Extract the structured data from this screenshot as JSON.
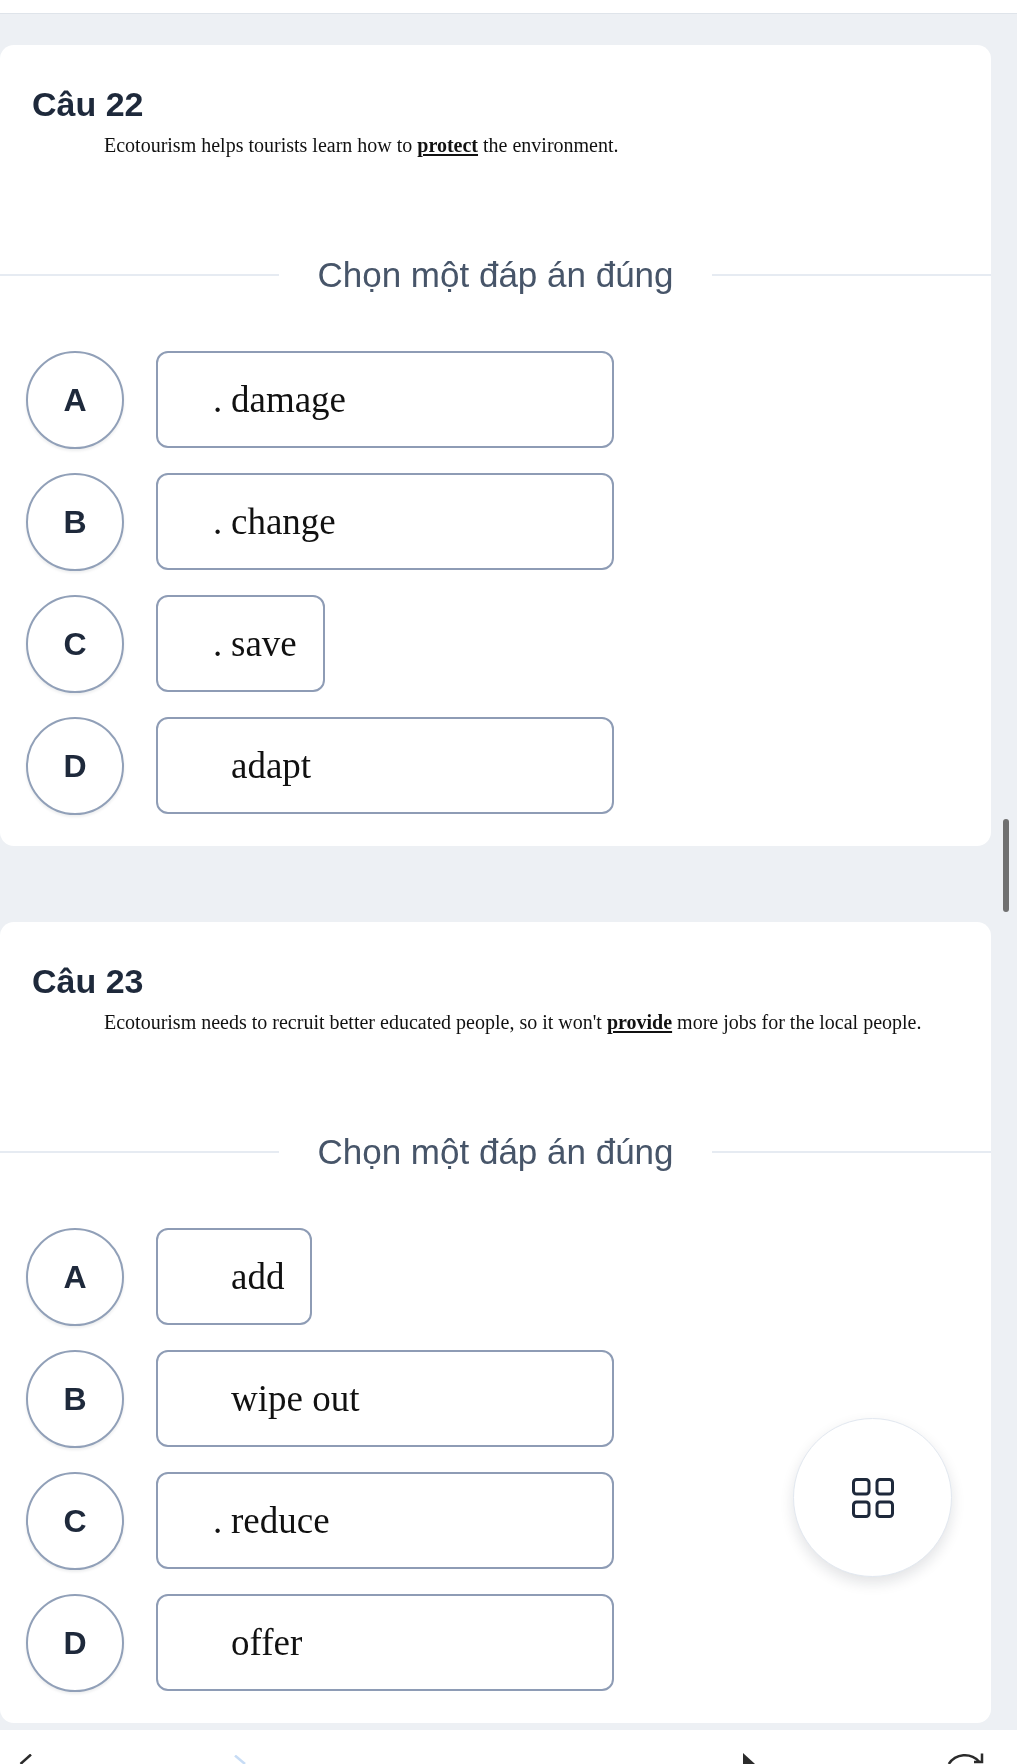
{
  "questions": [
    {
      "title": "Câu 22",
      "sentence": "Ecotourism helps tourists learn how to **protect** the environment.",
      "prompt": "Chọn một đáp án đúng",
      "options": [
        {
          "letter": "A",
          "prefix": ".",
          "text": "damage",
          "kind": "wide",
          "selected": false
        },
        {
          "letter": "B",
          "prefix": ".",
          "text": "change",
          "kind": "wide",
          "selected": false
        },
        {
          "letter": "C",
          "prefix": ".",
          "text": "save",
          "kind": "narrow",
          "selected": false
        },
        {
          "letter": "D",
          "text": "adapt",
          "kind": "wide",
          "selected": false
        }
      ]
    },
    {
      "title": "Câu 23",
      "sentence": "Ecotourism needs to recruit better educated people, so it won't **provide** more jobs for the local people.",
      "prompt": "Chọn một đáp án đúng",
      "options": [
        {
          "letter": "A",
          "text": "add",
          "kind": "narrow",
          "selected": false
        },
        {
          "letter": "B",
          "text": "wipe out",
          "kind": "wide",
          "selected": false
        },
        {
          "letter": "C",
          "prefix": ".",
          "text": "reduce",
          "kind": "wide",
          "selected": false
        },
        {
          "letter": "D",
          "text": "offer",
          "kind": "wide",
          "selected": false
        }
      ]
    }
  ]
}
